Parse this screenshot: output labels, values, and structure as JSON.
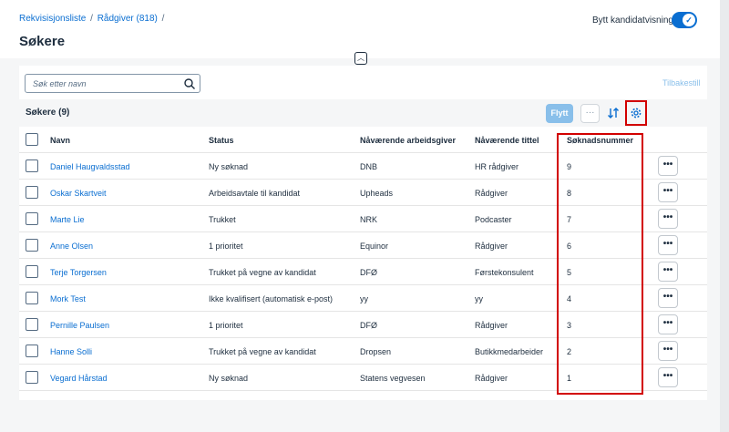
{
  "breadcrumb": {
    "items": [
      "Rekvisisjonsliste",
      "Rådgiver (818)"
    ],
    "separator": "/"
  },
  "page": {
    "title": "Søkere"
  },
  "toggle": {
    "label": "Bytt kandidatvisning",
    "checked": true
  },
  "search": {
    "placeholder": "Søk etter navn"
  },
  "toolbar": {
    "reset_label": "Tilbakestill",
    "move_label": "Flytt",
    "more_label": "···"
  },
  "table": {
    "title": "Søkere (9)",
    "columns": [
      "Navn",
      "Status",
      "Nåværende arbeidsgiver",
      "Nåværende tittel",
      "Søknadsnummer"
    ],
    "rows": [
      {
        "name": "Daniel Haugvaldsstad",
        "status": "Ny søknad",
        "employer": "DNB",
        "title": "HR rådgiver",
        "number": "9"
      },
      {
        "name": "Oskar Skartveit",
        "status": "Arbeidsavtale til kandidat",
        "employer": "Upheads",
        "title": "Rådgiver",
        "number": "8"
      },
      {
        "name": "Marte Lie",
        "status": "Trukket",
        "employer": "NRK",
        "title": "Podcaster",
        "number": "7"
      },
      {
        "name": "Anne Olsen",
        "status": "1 prioritet",
        "employer": "Equinor",
        "title": "Rådgiver",
        "number": "6"
      },
      {
        "name": "Terje Torgersen",
        "status": "Trukket på vegne av kandidat",
        "employer": "DFØ",
        "title": "Førstekonsulent",
        "number": "5"
      },
      {
        "name": "Mork Test",
        "status": "Ikke kvalifisert (automatisk e-post)",
        "employer": "yy",
        "title": "yy",
        "number": "4"
      },
      {
        "name": "Pernille Paulsen",
        "status": "1 prioritet",
        "employer": "DFØ",
        "title": "Rådgiver",
        "number": "3"
      },
      {
        "name": "Hanne Solli",
        "status": "Trukket på vegne av kandidat",
        "employer": "Dropsen",
        "title": "Butikkmedarbeider",
        "number": "2"
      },
      {
        "name": "Vegard Hårstad",
        "status": "Ny søknad",
        "employer": "Statens vegvesen",
        "title": "Rådgiver",
        "number": "1"
      }
    ],
    "row_action_label": "•••"
  },
  "colors": {
    "accent": "#0a6ed1",
    "highlight": "#d20000",
    "disabled_accent": "#89bfea"
  }
}
